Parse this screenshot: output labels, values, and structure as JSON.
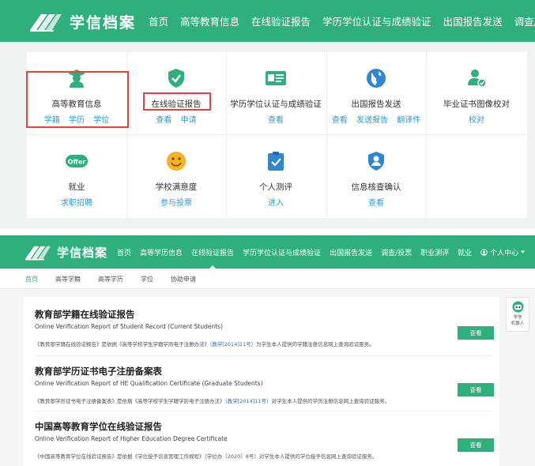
{
  "brand": {
    "name": "学信档案",
    "color": "#2eaf7d"
  },
  "top_nav": {
    "items": [
      "首页",
      "高等教育信息",
      "在线验证报告",
      "学历学位认证与成绩验证",
      "出国报告发送",
      "调查/投票"
    ]
  },
  "service_grid": {
    "tiles": [
      {
        "title": "高等教育信息",
        "links": [
          "学籍",
          "学历",
          "学位"
        ],
        "icon": "graduate-icon",
        "highlighted": true
      },
      {
        "title": "在线验证报告",
        "links": [
          "查看",
          "申请"
        ],
        "icon": "shield-check-icon",
        "highlighted": true
      },
      {
        "title": "学历学位认证与成绩验证",
        "links": [
          "查看"
        ],
        "icon": "certificate-card-icon"
      },
      {
        "title": "出国报告发送",
        "links": [
          "查看",
          "发送报告",
          "翻译件"
        ],
        "icon": "globe-icon"
      },
      {
        "title": "毕业证书图像校对",
        "links": [
          "校对"
        ],
        "icon": "user-check-icon"
      },
      {
        "title": "就业",
        "links": [
          "求职招聘"
        ],
        "icon": "offer-icon",
        "icon_text": "Offer"
      },
      {
        "title": "学校满意度",
        "links": [
          "参与投票"
        ],
        "icon": "smiley-icon"
      },
      {
        "title": "个人测评",
        "links": [
          "进入"
        ],
        "icon": "clipboard-check-icon"
      },
      {
        "title": "信息核查确认",
        "links": [
          "查看"
        ],
        "icon": "user-shield-icon"
      }
    ]
  },
  "second_nav": {
    "items": [
      "首页",
      "高等学历信息",
      "在线验证报告",
      "学历学位认证与成绩验证",
      "出国报告发送",
      "调查/投票",
      "职业测评",
      "就业"
    ],
    "active_index": 2,
    "user_menu": "个人中心"
  },
  "sub_nav": {
    "items": [
      "首页",
      "高等学籍",
      "高等学历",
      "学位",
      "协助申请"
    ],
    "active_index": 0
  },
  "reports": [
    {
      "title": "教育部学籍在线验证报告",
      "english": "Online Verification Report of Student Record (Current Students)",
      "desc_before": "《教育部学籍在线验证报告》是依据《高等学校学生学籍学历电子注册办法》",
      "desc_ref": "（教学[2014]11号）",
      "desc_after": "为学生本人提供的学籍注册信息网上查询验证服务。",
      "button": "查看"
    },
    {
      "title": "教育部学历证书电子注册备案表",
      "english": "Online Verification Report of HE Qualification Certificate (Graduate Students)",
      "desc_before": "《教育部学历证书电子注册备案表》是依据《高等学校学生学籍学历电子注册办法》",
      "desc_ref": "（教学[2014]11号）",
      "desc_after": "对学生本人提供的学历注册信息网上查询验证服务。",
      "button": "查看"
    },
    {
      "title": "中国高等教育学位在线验证报告",
      "english": "Online Verification Report of Higher Education Degree Certificate",
      "desc_before": "《中国高等教育学位在线验证报告》是依据《学位授予信息管理工作规程》（学位办〔2020〕8号）对学生本人提供的学位授予信息网上查询验证服务。",
      "desc_ref": "",
      "desc_after": "",
      "button": "查看"
    }
  ],
  "robot": {
    "label_line1": "学信",
    "label_line2": "机器人"
  }
}
